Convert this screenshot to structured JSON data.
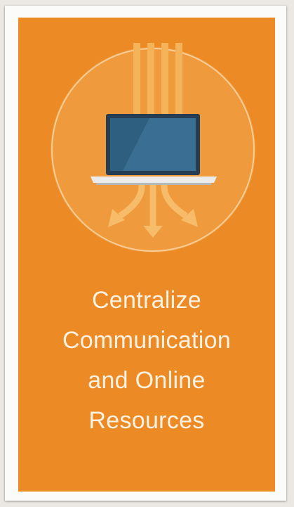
{
  "card": {
    "background": "#ec8b26",
    "icon": "laptop-with-arrows-icon",
    "title_lines": [
      "Centralize",
      "Communication",
      "and Online",
      "Resources"
    ]
  }
}
